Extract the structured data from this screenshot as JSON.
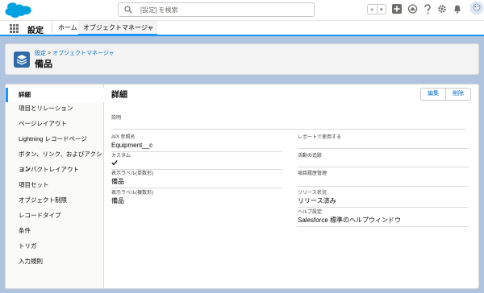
{
  "header": {
    "search_placeholder": "[設定] を検索"
  },
  "nav": {
    "app_name": "設定",
    "tabs": [
      {
        "label": "ホーム"
      },
      {
        "label": "オブジェクトマネージャ"
      }
    ]
  },
  "object_header": {
    "breadcrumb_setup": "設定",
    "breadcrumb_separator": ">",
    "breadcrumb_object_manager": "オブジェクトマネージャ",
    "title": "備品"
  },
  "sidebar": {
    "items": [
      {
        "label": "詳細"
      },
      {
        "label": "項目とリレーション"
      },
      {
        "label": "ページレイアウト"
      },
      {
        "label": "Lightning レコードページ"
      },
      {
        "label": "ボタン、リンク、およびアクション"
      },
      {
        "label": "コンパクトレイアウト"
      },
      {
        "label": "項目セット"
      },
      {
        "label": "オブジェクト制限"
      },
      {
        "label": "レコードタイプ"
      },
      {
        "label": "条件"
      },
      {
        "label": "トリガ"
      },
      {
        "label": "入力規則"
      }
    ]
  },
  "details": {
    "title": "詳細",
    "edit_label": "編集",
    "delete_label": "削除",
    "description_label": "説明",
    "description_value": "",
    "left_fields": [
      {
        "label": "API 参照名",
        "value": "Equipment__c"
      },
      {
        "label": "カスタム",
        "value": ""
      },
      {
        "label": "表示ラベル(単数形)",
        "value": "備品"
      },
      {
        "label": "表示ラベル(複数形)",
        "value": "備品"
      }
    ],
    "right_fields": [
      {
        "label": "レポートで使用する",
        "value": ""
      },
      {
        "label": "活動の追跡",
        "value": ""
      },
      {
        "label": "項目履歴管理",
        "value": ""
      },
      {
        "label": "リリース状況",
        "value": "リリース済み"
      },
      {
        "label": "ヘルプ設定",
        "value": "Salesforce 標準のヘルプウィンドウ"
      }
    ],
    "custom_checked": true
  },
  "colors": {
    "accent": "#1b96ff",
    "background": "#b0c4df",
    "object_icon": "#2e6ca8",
    "link": "#006dcc"
  },
  "icons": [
    "salesforce-logo",
    "search-icon",
    "star-icon",
    "add-icon",
    "trailhead-icon",
    "help-icon",
    "gear-icon",
    "bell-icon",
    "avatar",
    "app-launcher-icon",
    "layers-icon",
    "check-icon"
  ]
}
